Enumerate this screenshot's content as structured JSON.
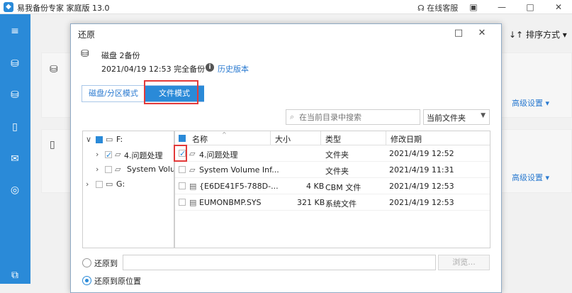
{
  "app": {
    "title": "易我备份专家 家庭版 13.0",
    "support": "在线客服",
    "sort_label": "排序方式",
    "advanced_settings": "高级设置"
  },
  "dialog": {
    "title": "还原",
    "disk_name": "磁盘 2备份",
    "backup_date": "2021/04/19 12:53 完全备份",
    "history_link": "历史版本",
    "tabs": {
      "partition": "磁盘/分区模式",
      "file": "文件模式"
    },
    "search": {
      "placeholder": "在当前目录中搜索"
    },
    "scope": "当前文件夹",
    "tree": [
      {
        "label": "F:"
      },
      {
        "label": "4.问题处理"
      },
      {
        "label": "System Volume"
      },
      {
        "label": "G:"
      }
    ],
    "columns": {
      "name": "名称",
      "size": "大小",
      "type": "类型",
      "modified": "修改日期"
    },
    "files": [
      {
        "name": "4.问题处理",
        "size": "",
        "type": "文件夹",
        "modified": "2021/4/19 12:52"
      },
      {
        "name": "System Volume Inf...",
        "size": "",
        "type": "文件夹",
        "modified": "2021/4/19 11:31"
      },
      {
        "name": "{E6DE41F5-788D-...",
        "size": "4 KB",
        "type": "CBM 文件",
        "modified": "2021/4/19 12:53"
      },
      {
        "name": "EUMONBMP.SYS",
        "size": "321 KB",
        "type": "系统文件",
        "modified": "2021/4/19 12:53"
      }
    ],
    "restore_to_label": "还原到",
    "browse": "浏览...",
    "restore_original": "还原到原位置"
  },
  "colors": {
    "accent": "#2a8ad8",
    "highlight": "#e23a3a"
  }
}
